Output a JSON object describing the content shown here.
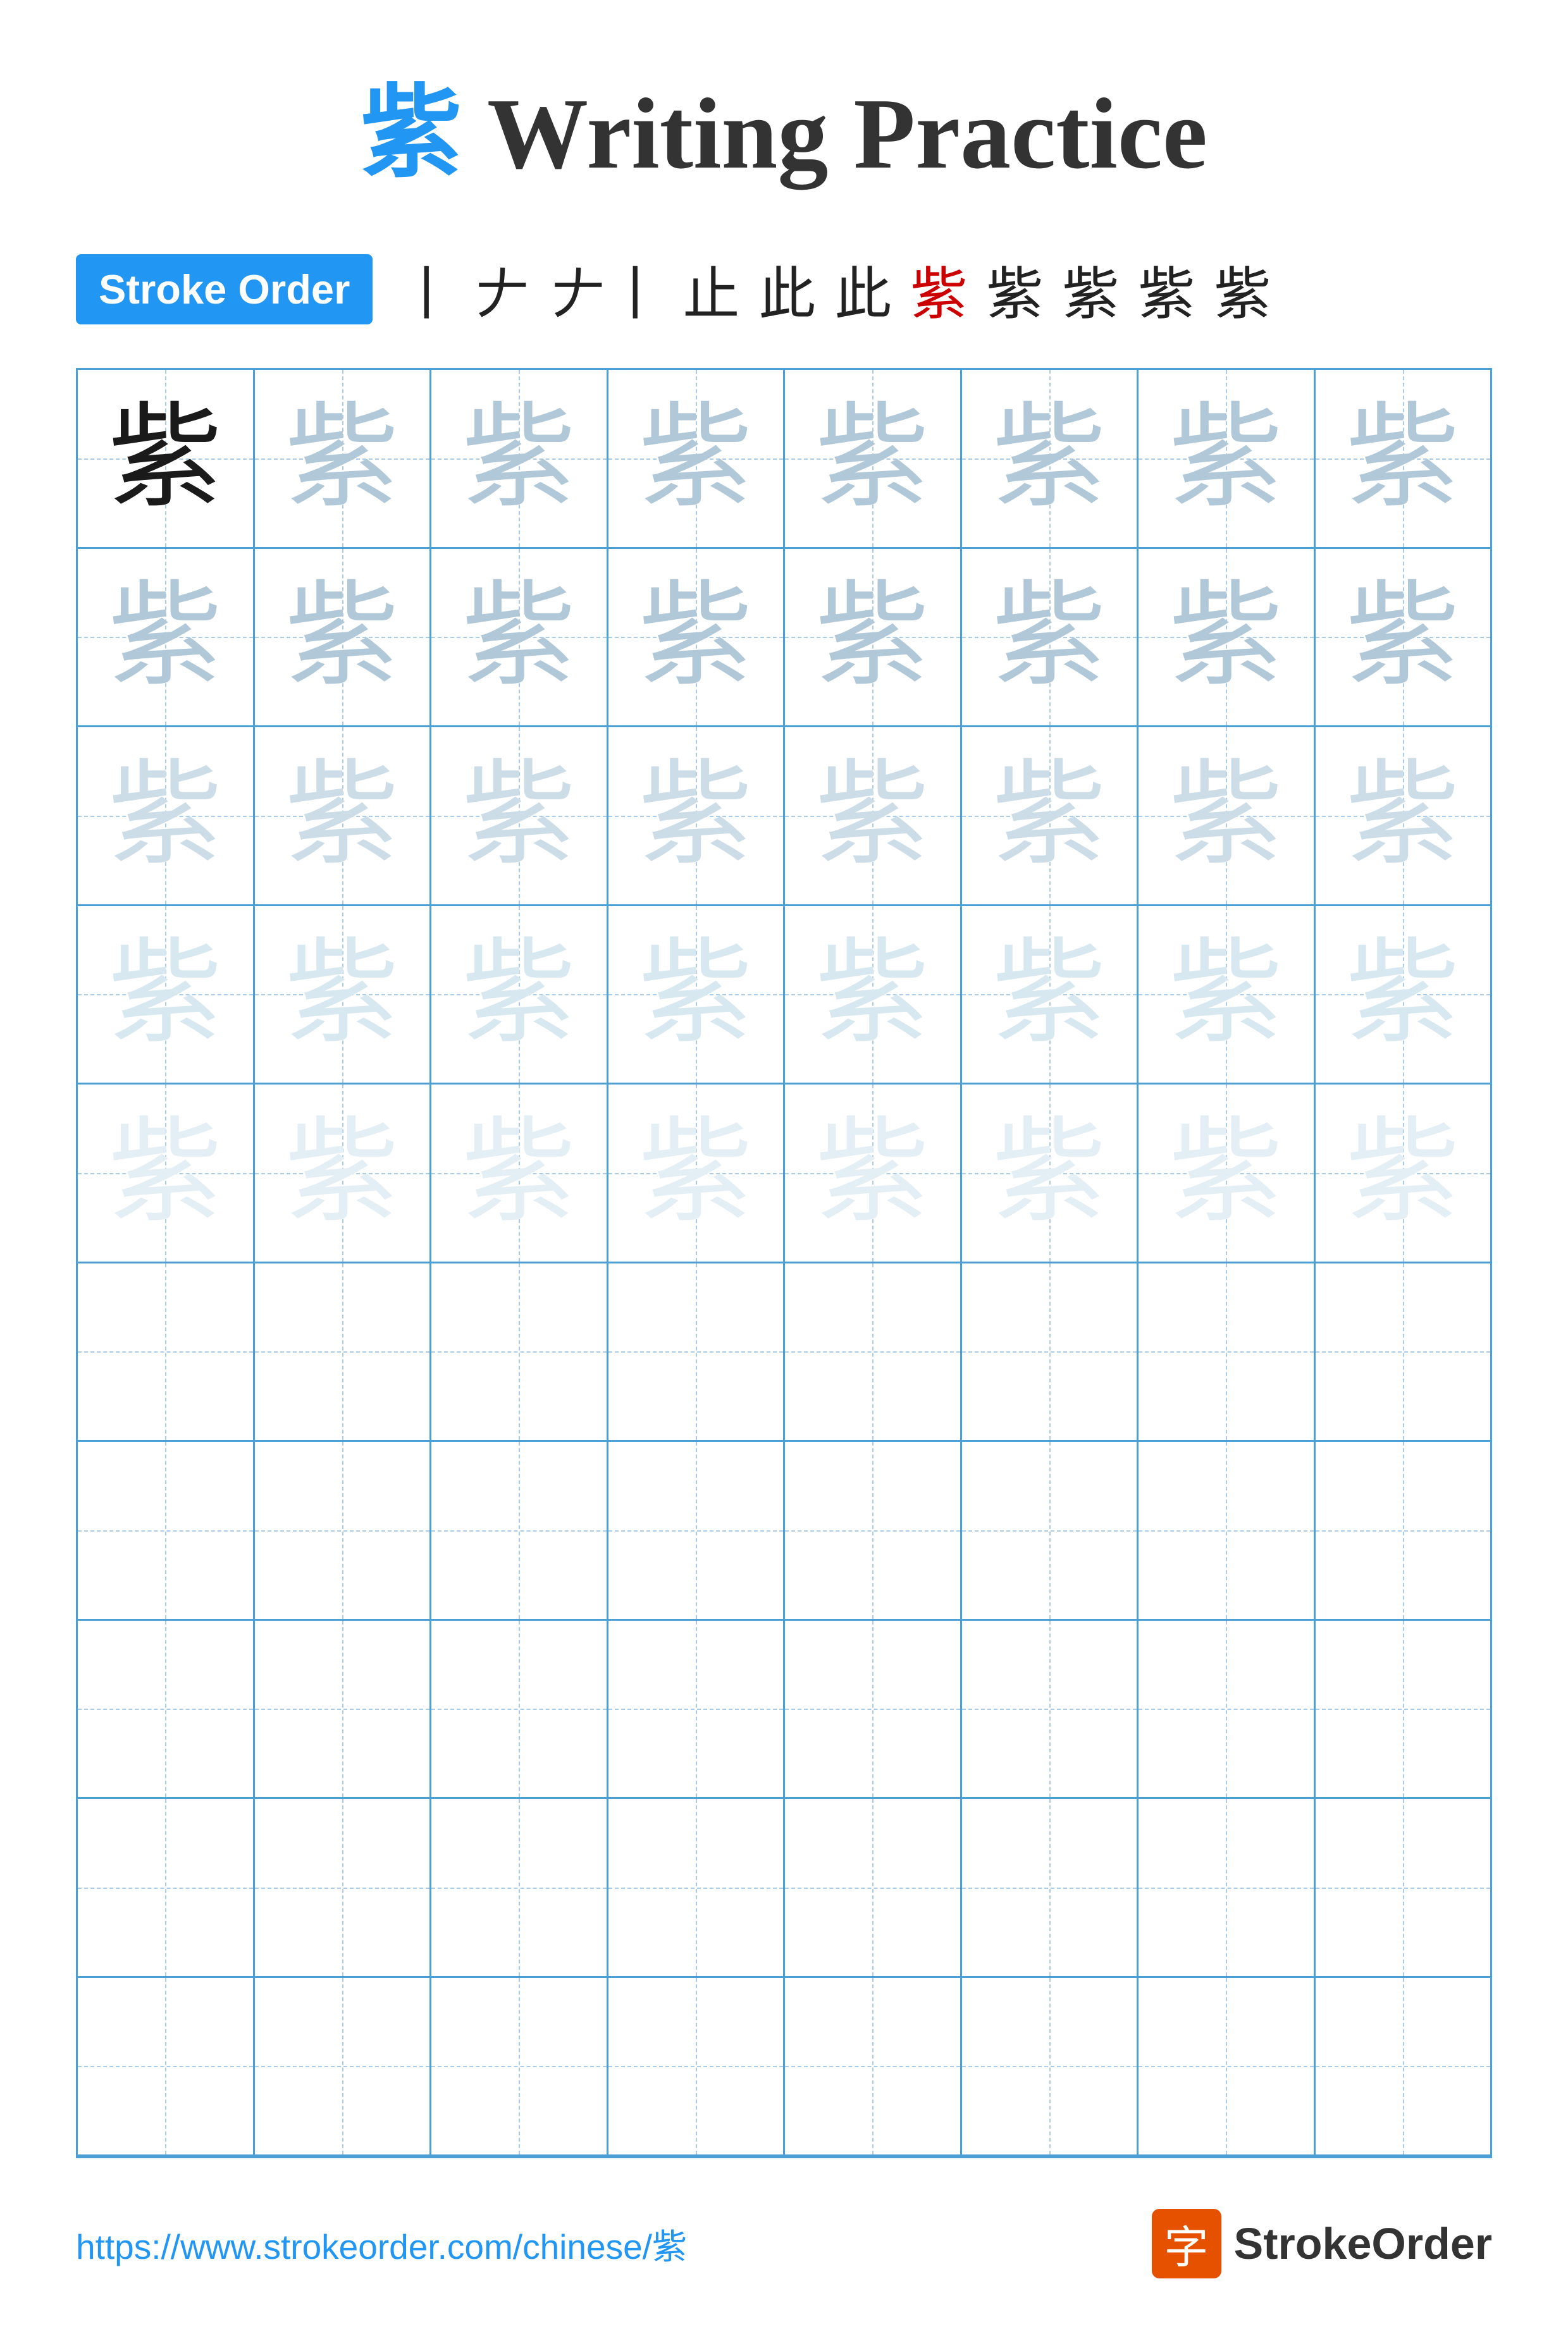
{
  "title": {
    "char": "紫",
    "rest": " Writing Practice"
  },
  "stroke_order": {
    "badge_label": "Stroke Order",
    "steps": [
      "丨",
      "𠂇",
      "𠂇丨",
      "止",
      "此",
      "此",
      "紫",
      "紫",
      "紫",
      "紫",
      "紫"
    ]
  },
  "character": "紫",
  "grid": {
    "rows": 10,
    "cols": 8
  },
  "footer": {
    "url": "https://www.strokeorder.com/chinese/紫",
    "logo_char": "字",
    "logo_name": "StrokeOrder"
  }
}
